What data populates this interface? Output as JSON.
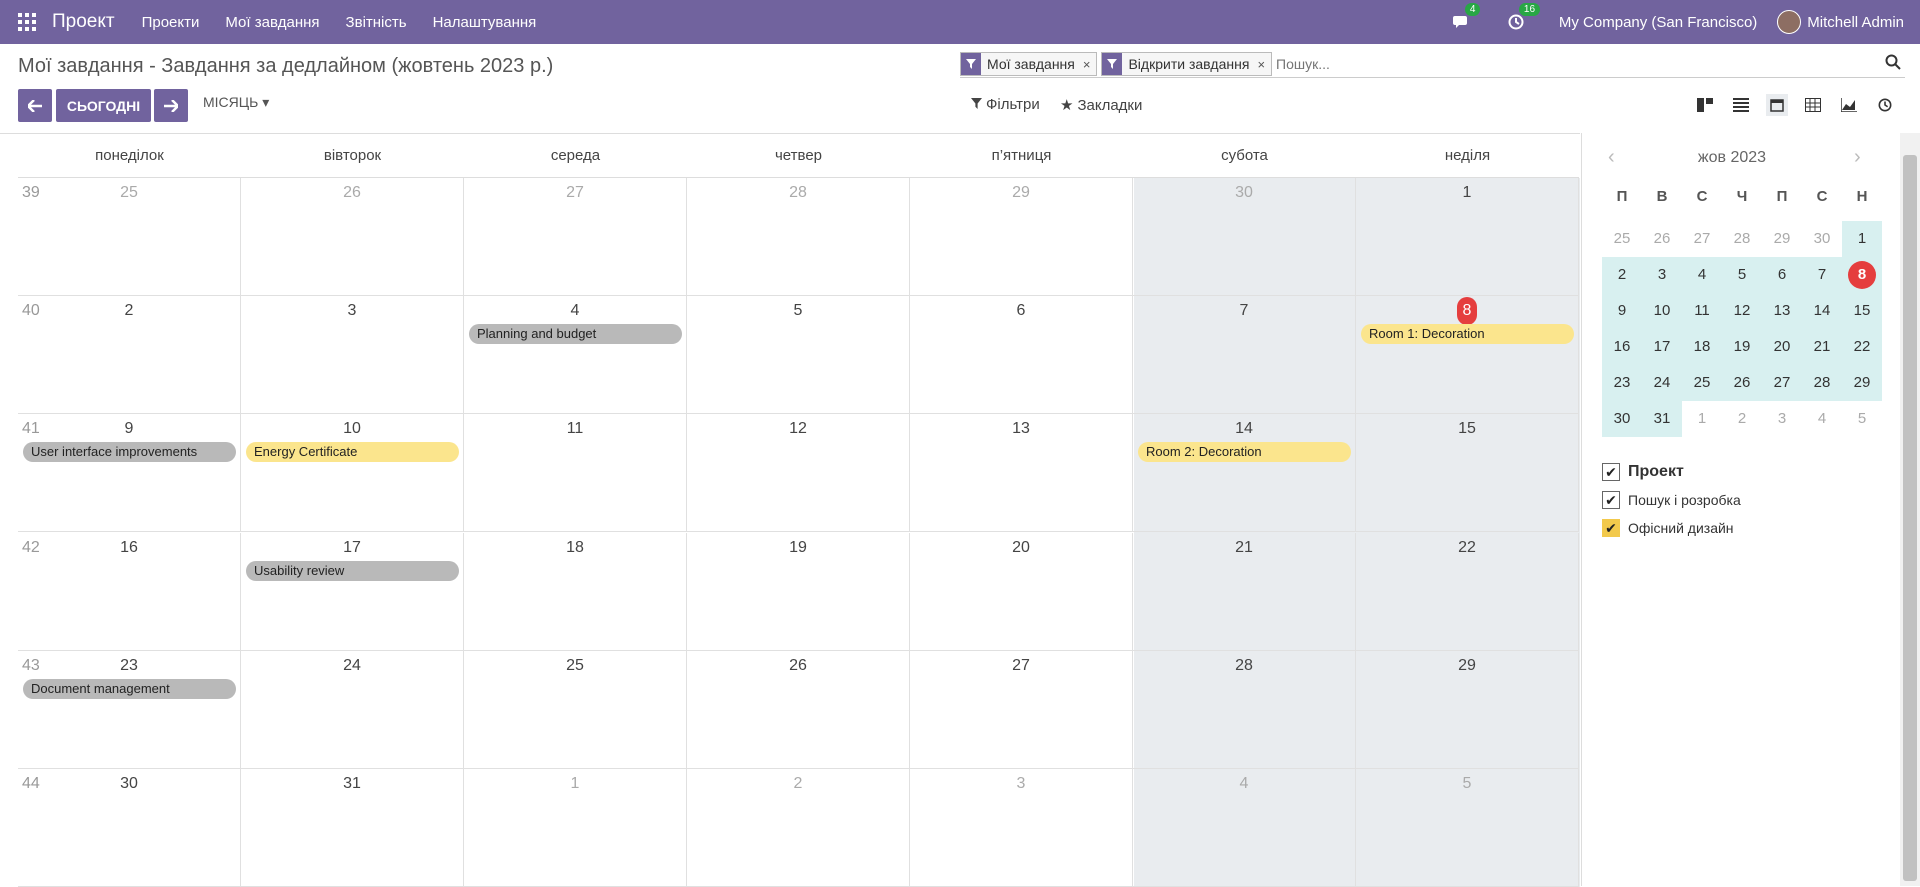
{
  "navbar": {
    "app_name": "Проект",
    "menu": [
      "Проекти",
      "Мої завдання",
      "Звітність",
      "Налаштування"
    ],
    "chat_badge": "4",
    "activity_badge": "16",
    "company": "My Company (San Francisco)",
    "user": "Mitchell Admin"
  },
  "breadcrumb": "Мої завдання - Завдання за дедлайном (жовтень 2023 р.)",
  "search": {
    "facets": [
      "Мої завдання",
      "Відкрити завдання"
    ],
    "placeholder": "Пошук..."
  },
  "toolbar": {
    "today": "СЬОГОДНІ",
    "scale": "МІСЯЦЬ",
    "filters": "Фільтри",
    "favorites": "Закладки"
  },
  "calendar": {
    "weekdays": [
      "понеділок",
      "вівторок",
      "середа",
      "четвер",
      "п’ятниця",
      "субота",
      "неділя"
    ],
    "weeks": [
      {
        "num": "39",
        "days": [
          {
            "d": "25",
            "other": true
          },
          {
            "d": "26",
            "other": true
          },
          {
            "d": "27",
            "other": true
          },
          {
            "d": "28",
            "other": true
          },
          {
            "d": "29",
            "other": true
          },
          {
            "d": "30",
            "other": true
          },
          {
            "d": "1"
          }
        ]
      },
      {
        "num": "40",
        "days": [
          {
            "d": "2"
          },
          {
            "d": "3"
          },
          {
            "d": "4",
            "event": "Planning and budget",
            "color": "grey"
          },
          {
            "d": "5"
          },
          {
            "d": "6"
          },
          {
            "d": "7"
          },
          {
            "d": "8",
            "today": true,
            "event": "Room 1: Decoration",
            "color": "yellow"
          }
        ]
      },
      {
        "num": "41",
        "days": [
          {
            "d": "9",
            "event": "User interface improvements",
            "color": "grey"
          },
          {
            "d": "10",
            "event": "Energy Certificate",
            "color": "yellow"
          },
          {
            "d": "11"
          },
          {
            "d": "12"
          },
          {
            "d": "13"
          },
          {
            "d": "14",
            "event": "Room 2: Decoration",
            "color": "yellow"
          },
          {
            "d": "15"
          }
        ]
      },
      {
        "num": "42",
        "days": [
          {
            "d": "16"
          },
          {
            "d": "17",
            "event": "Usability review",
            "color": "grey"
          },
          {
            "d": "18"
          },
          {
            "d": "19"
          },
          {
            "d": "20"
          },
          {
            "d": "21"
          },
          {
            "d": "22"
          }
        ]
      },
      {
        "num": "43",
        "days": [
          {
            "d": "23",
            "event": "Document management",
            "color": "grey"
          },
          {
            "d": "24"
          },
          {
            "d": "25"
          },
          {
            "d": "26"
          },
          {
            "d": "27"
          },
          {
            "d": "28"
          },
          {
            "d": "29"
          }
        ]
      },
      {
        "num": "44",
        "days": [
          {
            "d": "30"
          },
          {
            "d": "31"
          },
          {
            "d": "1",
            "other": true
          },
          {
            "d": "2",
            "other": true
          },
          {
            "d": "3",
            "other": true
          },
          {
            "d": "4",
            "other": true
          },
          {
            "d": "5",
            "other": true
          }
        ]
      }
    ]
  },
  "mini_calendar": {
    "title": "жов 2023",
    "weekdays": [
      "П",
      "В",
      "С",
      "Ч",
      "П",
      "С",
      "Н"
    ],
    "rows": [
      [
        "25",
        "26",
        "27",
        "28",
        "29",
        "30",
        "1"
      ],
      [
        "2",
        "3",
        "4",
        "5",
        "6",
        "7",
        "8"
      ],
      [
        "9",
        "10",
        "11",
        "12",
        "13",
        "14",
        "15"
      ],
      [
        "16",
        "17",
        "18",
        "19",
        "20",
        "21",
        "22"
      ],
      [
        "23",
        "24",
        "25",
        "26",
        "27",
        "28",
        "29"
      ],
      [
        "30",
        "31",
        "1",
        "2",
        "3",
        "4",
        "5"
      ]
    ]
  },
  "sidebar_filters": {
    "title": "Проект",
    "items": [
      "Пошук і розробка",
      "Офісний дизайн"
    ]
  },
  "colors": {
    "brand": "#71639e",
    "today": "#e53e3e",
    "event_grey": "#b9b9b9",
    "event_yellow": "#fbe58d",
    "weekend": "#e9ecef"
  }
}
